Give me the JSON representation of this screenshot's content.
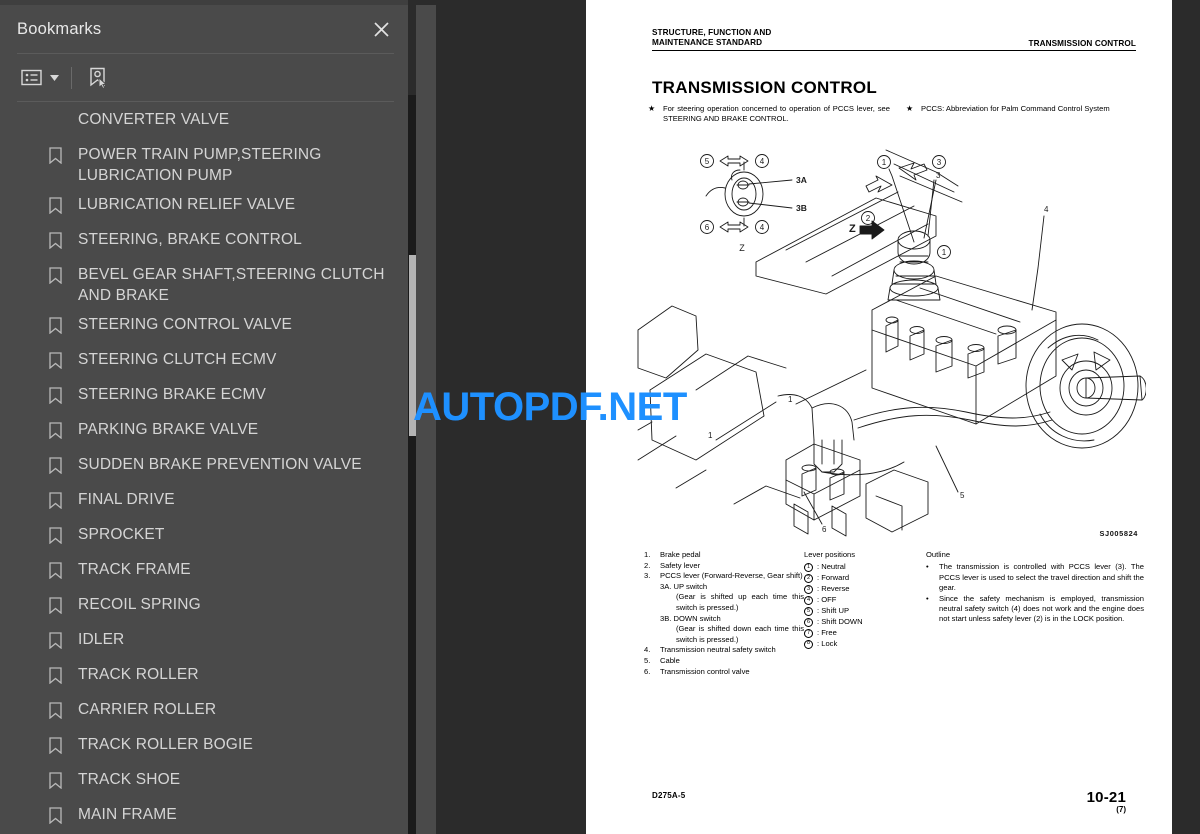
{
  "sidebar": {
    "title": "Bookmarks",
    "close_icon": "close-icon",
    "toolbar": {
      "list_options_icon": "list-options-icon",
      "caret_icon": "chevron-down-icon",
      "find_bookmark_icon": "find-bookmark-icon"
    },
    "bookmarks": [
      {
        "label": "CONVERTER VALVE",
        "partial": true
      },
      {
        "label": "POWER TRAIN PUMP,STEERING LUBRICATION PUMP"
      },
      {
        "label": "LUBRICATION RELIEF VALVE"
      },
      {
        "label": "STEERING, BRAKE CONTROL"
      },
      {
        "label": "BEVEL GEAR SHAFT,STEERING CLUTCH AND BRAKE"
      },
      {
        "label": "STEERING CONTROL VALVE"
      },
      {
        "label": "STEERING CLUTCH ECMV"
      },
      {
        "label": "STEERING BRAKE ECMV"
      },
      {
        "label": "PARKING BRAKE VALVE"
      },
      {
        "label": "SUDDEN BRAKE PREVENTION VALVE"
      },
      {
        "label": "FINAL DRIVE"
      },
      {
        "label": "SPROCKET"
      },
      {
        "label": "TRACK FRAME"
      },
      {
        "label": "RECOIL SPRING"
      },
      {
        "label": "IDLER"
      },
      {
        "label": "TRACK ROLLER"
      },
      {
        "label": "CARRIER ROLLER"
      },
      {
        "label": "TRACK ROLLER BOGIE"
      },
      {
        "label": "TRACK SHOE"
      },
      {
        "label": "MAIN FRAME"
      }
    ]
  },
  "watermark": {
    "text": "AUTOPDF.NET",
    "color": "#1e90ff"
  },
  "document": {
    "running_head_left_line1": "STRUCTURE, FUNCTION AND",
    "running_head_left_line2": "MAINTENANCE STANDARD",
    "running_head_right": "TRANSMISSION CONTROL",
    "title": "TRANSMISSION CONTROL",
    "notes": [
      {
        "marker": "★",
        "text": "For steering operation concerned to operation of PCCS lever, see STEERING AND BRAKE CONTROL."
      },
      {
        "marker": "★",
        "text": "PCCS: Abbreviation for Palm Command Control System"
      }
    ],
    "figure_id": "SJ005824",
    "figure_callouts": {
      "detail_label": "Z",
      "detail_items": [
        "5",
        "4",
        "6",
        "4",
        "3A",
        "3B"
      ],
      "main_items": [
        "1",
        "2",
        "3",
        "1",
        "4",
        "5",
        "6"
      ],
      "circled": [
        "1",
        "2",
        "3",
        "4",
        "5",
        "6"
      ]
    },
    "legend_numbers": [
      {
        "n": "1.",
        "t": "Brake pedal"
      },
      {
        "n": "2.",
        "t": "Safety lever"
      },
      {
        "n": "3.",
        "t": "PCCS lever (Forward-Reverse, Gear shift)"
      },
      {
        "n": "",
        "t": "3A. UP switch",
        "indent": 1
      },
      {
        "n": "",
        "t": "(Gear is shifted up each time this switch is pressed.)",
        "indent": 2
      },
      {
        "n": "",
        "t": "3B. DOWN switch",
        "indent": 1
      },
      {
        "n": "",
        "t": "(Gear is shifted down each time this switch is pressed.)",
        "indent": 2
      },
      {
        "n": "4.",
        "t": "Transmission neutral safety switch"
      },
      {
        "n": "5.",
        "t": "Cable"
      },
      {
        "n": "6.",
        "t": "Transmission control valve"
      }
    ],
    "lever_positions": {
      "title": "Lever positions",
      "items": [
        {
          "num": "1",
          "label": ": Neutral"
        },
        {
          "num": "2",
          "label": ": Forward"
        },
        {
          "num": "3",
          "label": ": Reverse"
        },
        {
          "num": "4",
          "label": ": OFF"
        },
        {
          "num": "5",
          "label": ": Shift UP"
        },
        {
          "num": "6",
          "label": ": Shift DOWN"
        },
        {
          "num": "7",
          "label": ": Free"
        },
        {
          "num": "8",
          "label": ": Lock"
        }
      ]
    },
    "outline": {
      "title": "Outline",
      "items": [
        "The transmission is controlled with PCCS lever (3). The PCCS lever is used to select the travel direction and shift the gear.",
        "Since the safety mechanism is employed, transmission neutral safety switch (4) does not work and the engine does not start unless safety lever (2) is in the LOCK position."
      ]
    },
    "footer_left": "D275A-5",
    "footer_page": "10-21",
    "footer_page_sub": "(7)"
  }
}
